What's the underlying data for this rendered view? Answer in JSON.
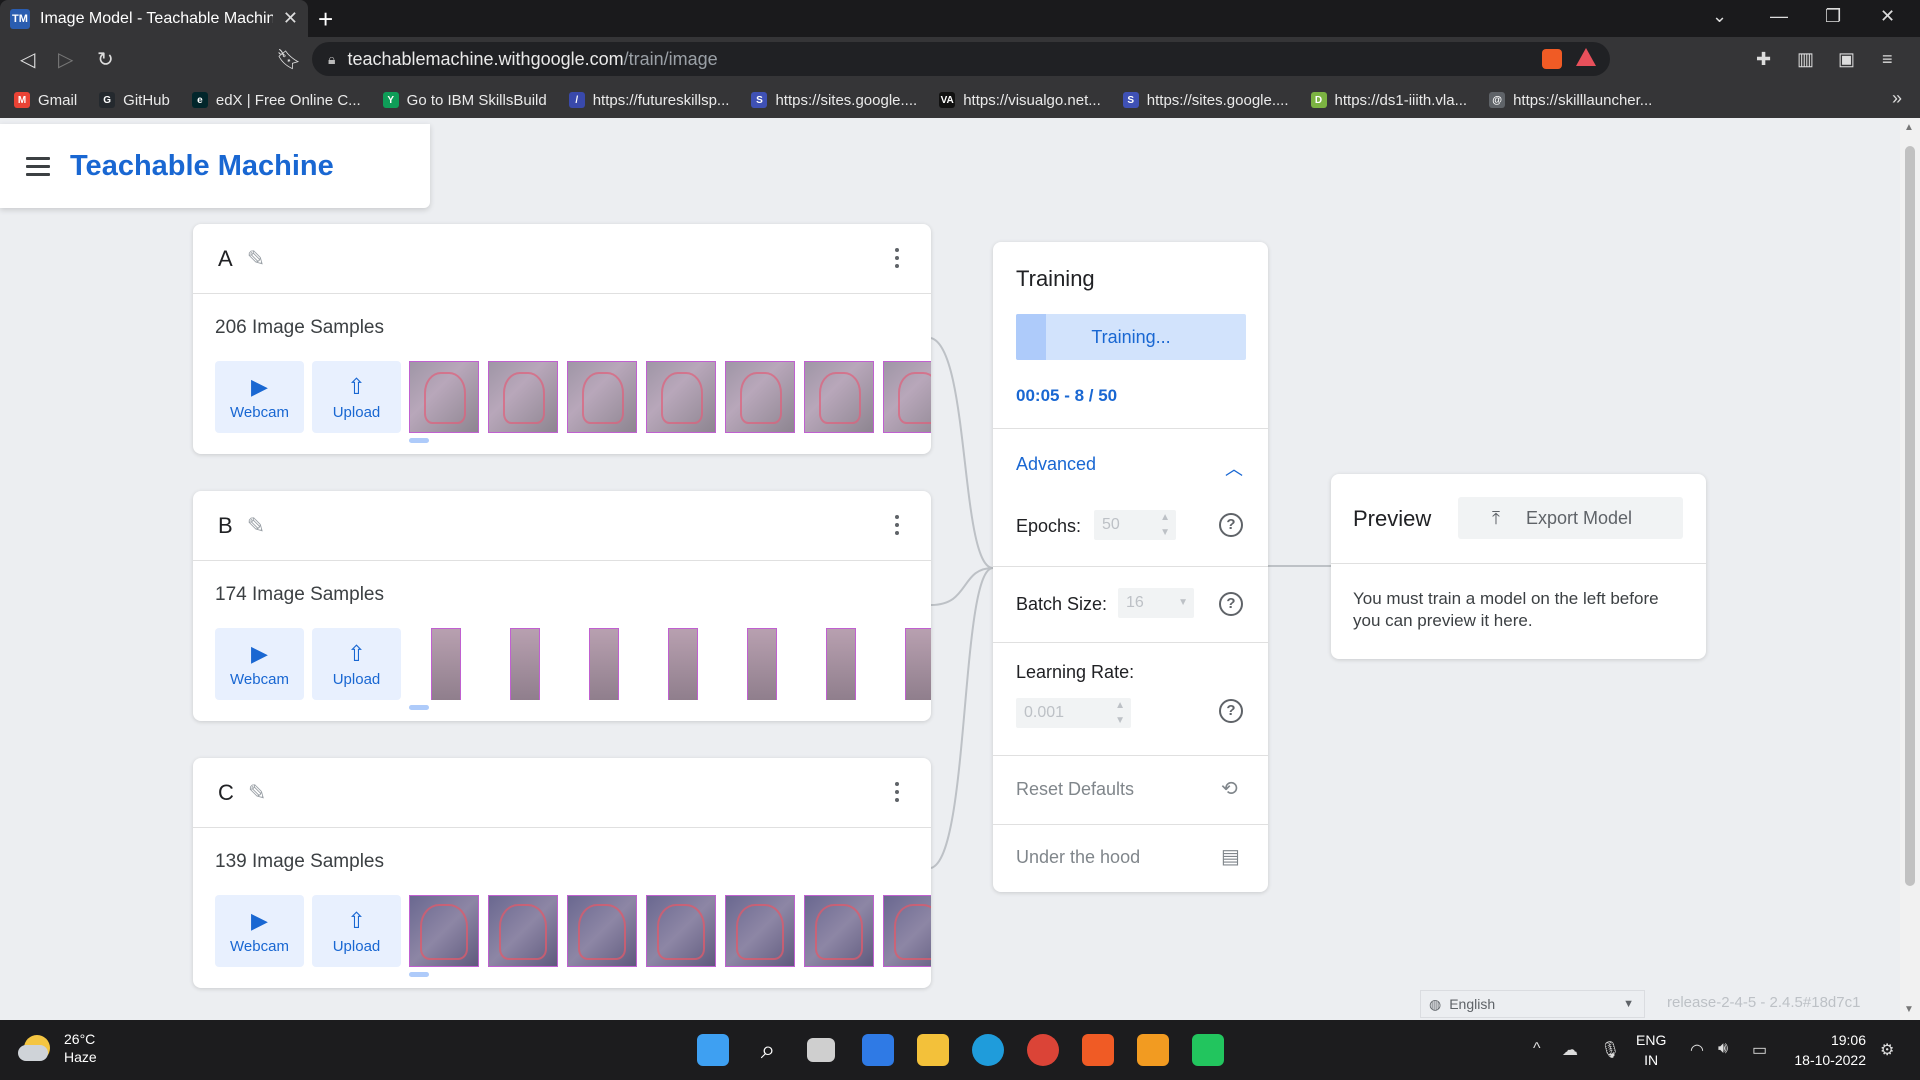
{
  "browser": {
    "tab_title": "Image Model - Teachable Machin",
    "tab_favicon": "TM",
    "url_host": "teachablemachine.withgoogle.com",
    "url_path": "/train/image",
    "bookmarks": [
      {
        "label": "Gmail",
        "icon": "gmail-icon",
        "color": "#ea4335",
        "glyph": "M"
      },
      {
        "label": "GitHub",
        "icon": "github-icon",
        "color": "#24292e",
        "glyph": "G"
      },
      {
        "label": "edX | Free Online C...",
        "icon": "edx-icon",
        "color": "#02262b",
        "glyph": "e"
      },
      {
        "label": "Go to IBM SkillsBuild",
        "icon": "ibm-icon",
        "color": "#0f9d58",
        "glyph": "Y"
      },
      {
        "label": "https://futureskillsp...",
        "icon": "futureskills-icon",
        "color": "#3949ab",
        "glyph": "/"
      },
      {
        "label": "https://sites.google....",
        "icon": "google-sites-icon",
        "color": "#3f51b5",
        "glyph": "S"
      },
      {
        "label": "https://visualgo.net...",
        "icon": "visualgo-icon",
        "color": "#111111",
        "glyph": "VA"
      },
      {
        "label": "https://sites.google....",
        "icon": "google-sites-icon",
        "color": "#3f51b5",
        "glyph": "S"
      },
      {
        "label": "https://ds1-iiith.vla...",
        "icon": "ds1-icon",
        "color": "#7cb342",
        "glyph": "D"
      },
      {
        "label": "https://skilllauncher...",
        "icon": "globe-icon",
        "color": "#5f6368",
        "glyph": "@"
      }
    ]
  },
  "app": {
    "title": "Teachable Machine"
  },
  "classes": [
    {
      "name": "A",
      "samples": "206 Image Samples",
      "webcam": "Webcam",
      "upload": "Upload"
    },
    {
      "name": "B",
      "samples": "174 Image Samples",
      "webcam": "Webcam",
      "upload": "Upload"
    },
    {
      "name": "C",
      "samples": "139 Image Samples",
      "webcam": "Webcam",
      "upload": "Upload"
    }
  ],
  "training": {
    "title": "Training",
    "button_label": "Training...",
    "progress_fraction": 0.13,
    "progress_text": "00:05 - 8 / 50",
    "advanced_label": "Advanced",
    "epochs_label": "Epochs:",
    "epochs_value": "50",
    "batch_label": "Batch Size:",
    "batch_value": "16",
    "lr_label": "Learning Rate:",
    "lr_value": "0.001",
    "reset_label": "Reset Defaults",
    "hood_label": "Under the hood",
    "help_glyph": "?"
  },
  "preview": {
    "title": "Preview",
    "export_label": "Export Model",
    "message": "You must train a model on the left before you can preview it here."
  },
  "footer": {
    "language": "English",
    "release": "release-2-4-5 - 2.4.5#18d7c1"
  },
  "taskbar": {
    "temp": "26°C",
    "weather": "Haze",
    "lang_line1": "ENG",
    "lang_line2": "IN",
    "time": "19:06",
    "date": "18-10-2022"
  },
  "colors": {
    "accent": "#1967d2",
    "accent_light": "#e8f0fe",
    "page_bg": "#eceef1"
  }
}
